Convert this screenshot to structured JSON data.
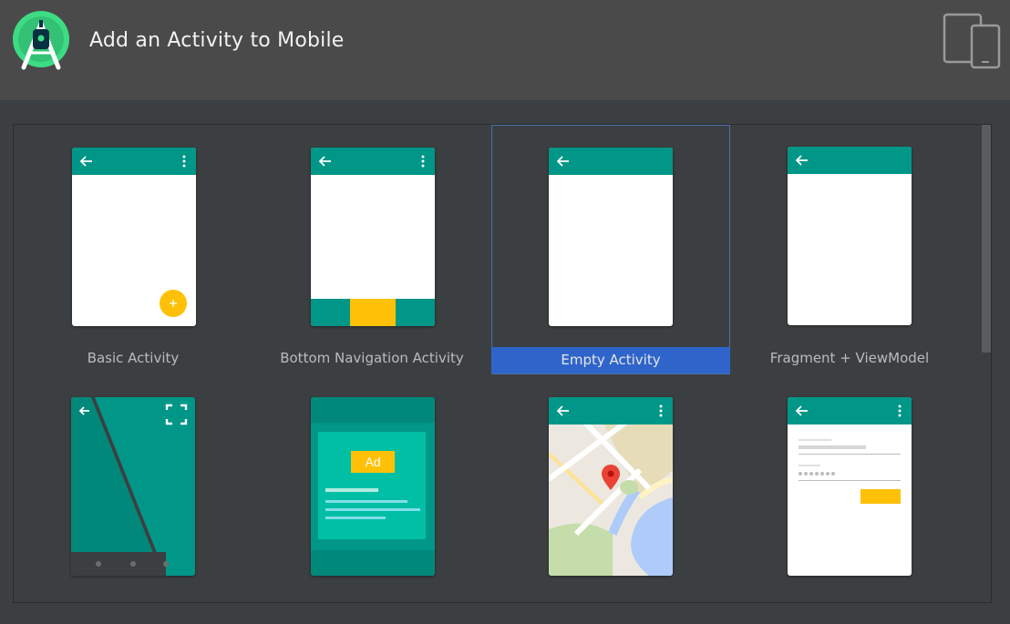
{
  "header": {
    "title": "Add an Activity to Mobile",
    "logo_icon": "android-studio-logo-icon",
    "devices_icon": "tablet-phone-icon"
  },
  "colors": {
    "header_bg": "#4a4a4a",
    "panel_bg": "#3c3f41",
    "appbar": "#009688",
    "accent": "#ffc107",
    "selection": "#2f65ca"
  },
  "templates": [
    {
      "label": "Basic Activity",
      "selected": false
    },
    {
      "label": "Bottom Navigation Activity",
      "selected": false
    },
    {
      "label": "Empty Activity",
      "selected": true
    },
    {
      "label": "Fragment + ViewModel",
      "selected": false
    },
    {
      "label": "",
      "selected": false
    },
    {
      "label": "",
      "selected": false
    },
    {
      "label": "",
      "selected": false
    },
    {
      "label": "",
      "selected": false
    }
  ],
  "ad_preview": {
    "badge": "Ad"
  }
}
